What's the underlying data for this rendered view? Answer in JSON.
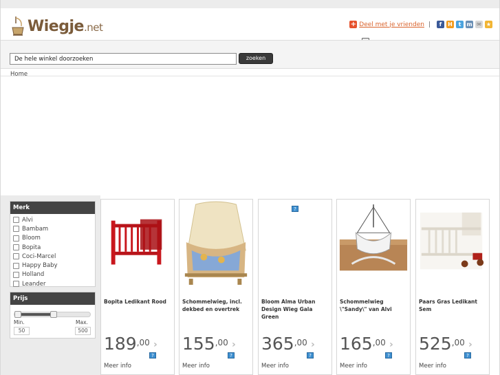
{
  "header": {
    "logo_text": "Wiegje",
    "logo_suffix": ".net",
    "share_label": "Deel met je vrienden",
    "separator": "|",
    "share_icons": [
      "facebook-icon",
      "hyves-icon",
      "twitter-icon",
      "myspace-icon",
      "email-icon",
      "bookmark-icon"
    ]
  },
  "search": {
    "value": "De hele winkel doorzoeken",
    "button_label": "zoeken"
  },
  "breadcrumb": "Home",
  "filters": {
    "merk_title": "Merk",
    "merk_items": [
      "Alvi",
      "Bambam",
      "Bloom",
      "Bopita",
      "Coci-Marcel",
      "Happy Baby",
      "Holland",
      "Leander"
    ],
    "prijs_title": "Prijs",
    "min_label": "Min.",
    "max_label": "Max.",
    "min_value": "50",
    "max_value": "500"
  },
  "products": [
    {
      "name": "Bopita Ledikant Rood",
      "price": "189",
      "cents": ",00",
      "more": "Meer info",
      "image": "red-crib"
    },
    {
      "name": "Schommelwieg, incl. dekbed en overtrek",
      "price": "155",
      "cents": ",00",
      "more": "Meer info",
      "image": "canopy-cradle"
    },
    {
      "name": "Bloom Alma Urban Design Wieg Gala Green",
      "price": "365",
      "cents": ",00",
      "more": "Meer info",
      "image": "missing-image"
    },
    {
      "name": "Schommelwieg \\\"Sandy\\\" van Alvi",
      "price": "165",
      "cents": ",00",
      "more": "Meer info",
      "image": "white-cradle"
    },
    {
      "name": "Paars Gras Ledikant Sem",
      "price": "525",
      "cents": ",00",
      "more": "Meer info",
      "image": "white-crib"
    }
  ],
  "colors": {
    "accent": "#d9622b",
    "panel_head": "#444444",
    "button": "#3a3a3a"
  }
}
